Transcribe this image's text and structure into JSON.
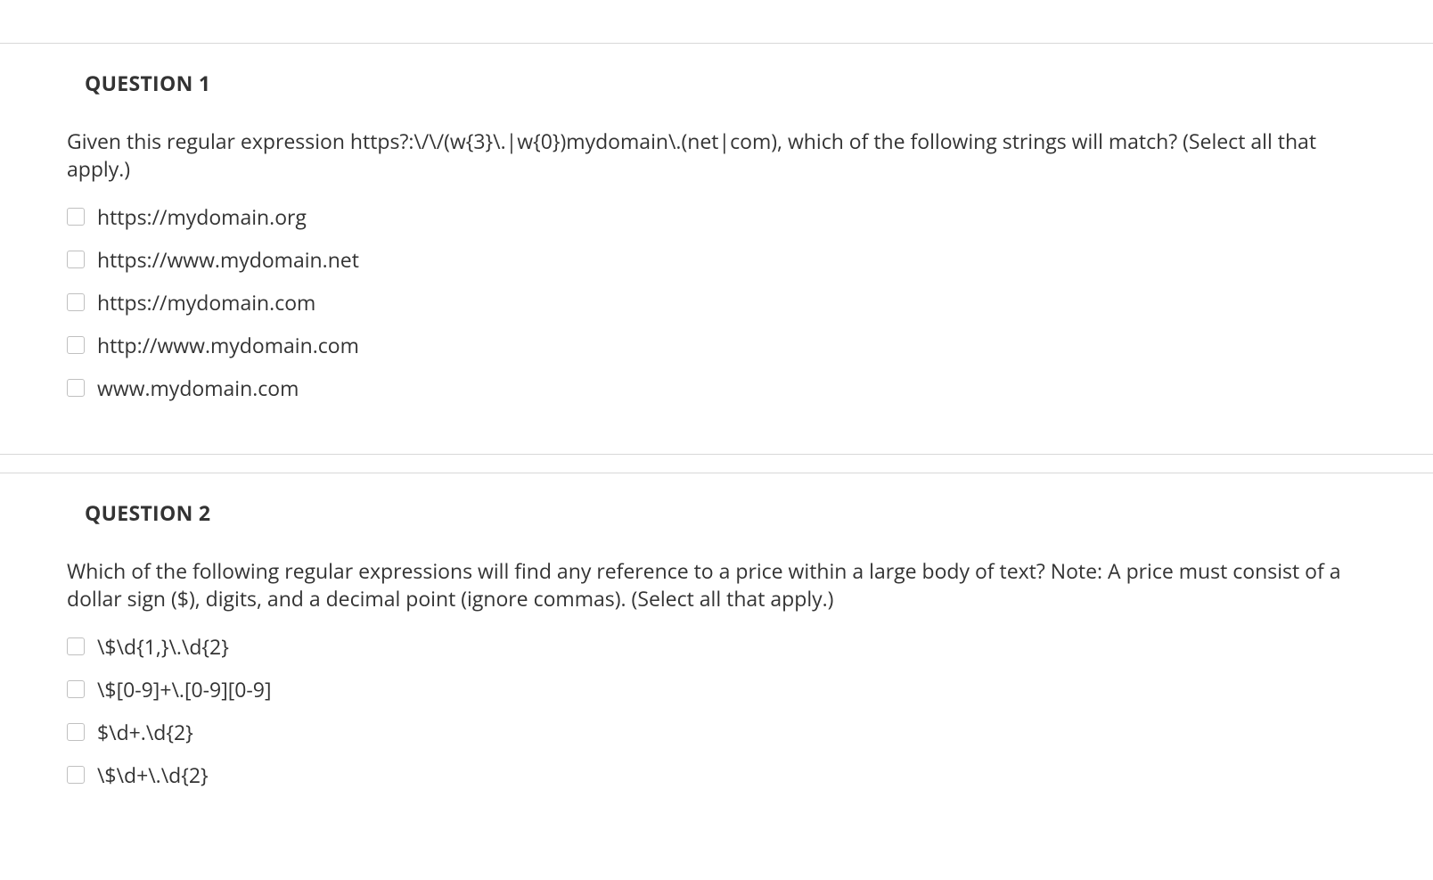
{
  "questions": [
    {
      "title": "QUESTION 1",
      "text": "Given this regular expression https?:\\/\\/(w{3}\\.|w{0})mydomain\\.(net|com), which of the following strings will match? (Select all that apply.)",
      "options": [
        "https://mydomain.org",
        "https://www.mydomain.net",
        "https://mydomain.com",
        "http://www.mydomain.com",
        "www.mydomain.com"
      ]
    },
    {
      "title": "QUESTION 2",
      "text": "Which of the following regular expressions will find any reference to a price within a large body of text? Note: A price must consist of a dollar sign ($), digits, and a decimal point (ignore commas). (Select all that apply.)",
      "options": [
        "\\$\\d{1,}\\.\\d{2}",
        "\\$[0-9]+\\.[0-9][0-9]",
        "$\\d+.\\d{2}",
        "\\$\\d+\\.\\d{2}"
      ]
    }
  ]
}
